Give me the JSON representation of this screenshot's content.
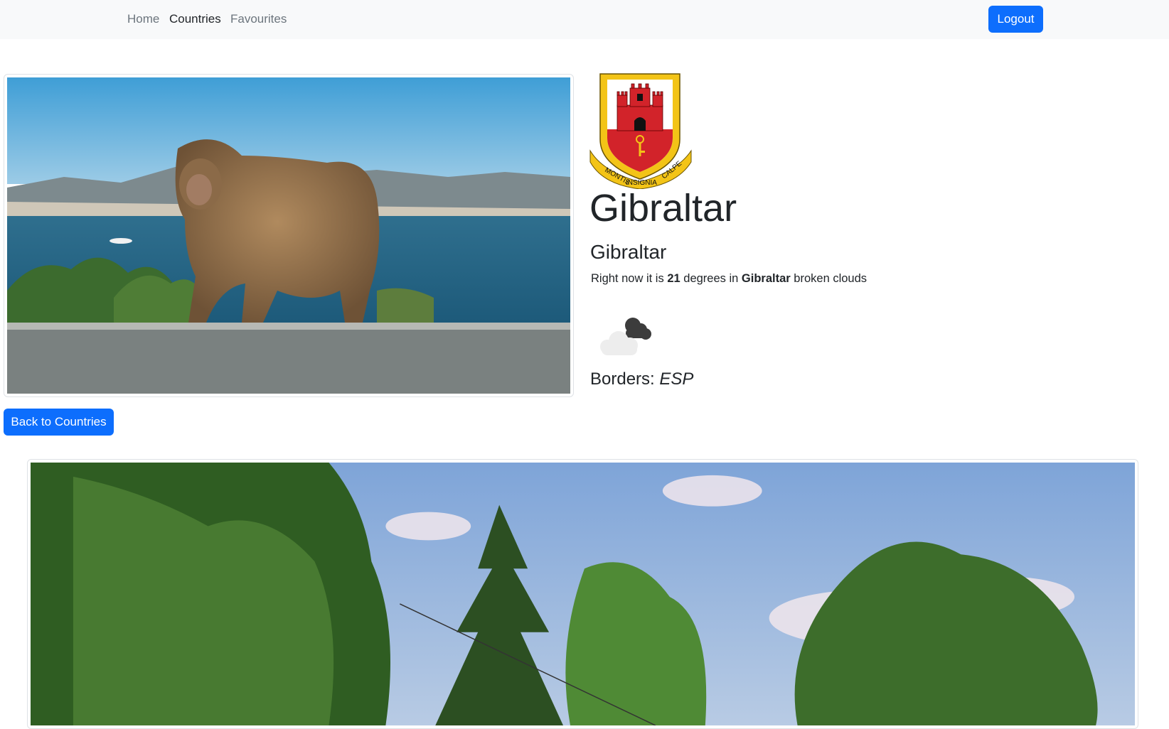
{
  "nav": {
    "links": [
      {
        "label": "Home"
      },
      {
        "label": "Countries"
      },
      {
        "label": "Favourites"
      }
    ],
    "active": "Countries",
    "logout_label": "Logout"
  },
  "country": {
    "name": "Gibraltar",
    "capital": "Gibraltar",
    "crest_motto": [
      "MONTIS",
      "INSIGNIA",
      "CALPE"
    ]
  },
  "weather": {
    "prefix": "Right now it is",
    "temperature": "21",
    "middle": "degrees in",
    "city": "Gibraltar",
    "description": "broken clouds",
    "icon": "broken-clouds-icon"
  },
  "borders": {
    "label": "Borders:",
    "codes": "ESP"
  },
  "actions": {
    "back_label": "Back to Countries"
  },
  "colors": {
    "primary": "#0d6efd",
    "navbar_bg": "#f8f9fa"
  }
}
